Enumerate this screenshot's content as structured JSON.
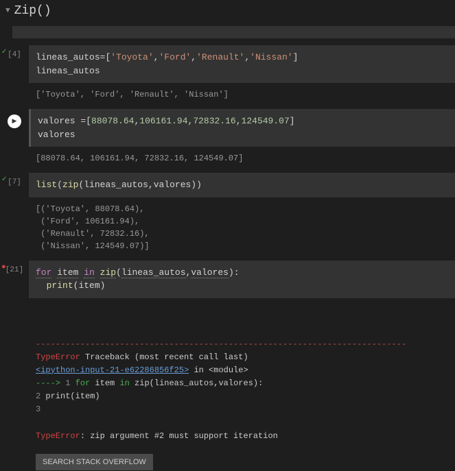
{
  "header": {
    "title": "Zip()"
  },
  "cells": [
    {
      "exec": "[4]",
      "status": "ok",
      "code_tokens": [
        {
          "t": "lineas_autos",
          "c": "c-var"
        },
        {
          "t": "=",
          "c": "c-op"
        },
        {
          "t": "[",
          "c": "c-pun"
        },
        {
          "t": "'Toyota'",
          "c": "c-str"
        },
        {
          "t": ",",
          "c": "c-pun"
        },
        {
          "t": "'Ford'",
          "c": "c-str"
        },
        {
          "t": ",",
          "c": "c-pun"
        },
        {
          "t": "'Renault'",
          "c": "c-str"
        },
        {
          "t": ",",
          "c": "c-pun"
        },
        {
          "t": "'Nissan'",
          "c": "c-str"
        },
        {
          "t": "]",
          "c": "c-pun"
        },
        {
          "t": "\n",
          "c": ""
        },
        {
          "t": "lineas_autos",
          "c": "c-var"
        }
      ],
      "output": "['Toyota', 'Ford', 'Renault', 'Nissan']"
    },
    {
      "exec": "",
      "status": "play",
      "code_tokens": [
        {
          "t": "valores ",
          "c": "c-var"
        },
        {
          "t": "=",
          "c": "c-op"
        },
        {
          "t": "[",
          "c": "c-pun"
        },
        {
          "t": "88078.64",
          "c": "c-num"
        },
        {
          "t": ",",
          "c": "c-pun"
        },
        {
          "t": "106161.94",
          "c": "c-num"
        },
        {
          "t": ",",
          "c": "c-pun"
        },
        {
          "t": "72832.16",
          "c": "c-num"
        },
        {
          "t": ",",
          "c": "c-pun"
        },
        {
          "t": "124549.07",
          "c": "c-num"
        },
        {
          "t": "]",
          "c": "c-pun"
        },
        {
          "t": "\n",
          "c": ""
        },
        {
          "t": "valores",
          "c": "c-var"
        }
      ],
      "output": "[88078.64, 106161.94, 72832.16, 124549.07]"
    },
    {
      "exec": "[7]",
      "status": "ok",
      "code_tokens": [
        {
          "t": "list",
          "c": "c-fn"
        },
        {
          "t": "(",
          "c": "c-pun"
        },
        {
          "t": "zip",
          "c": "c-fn"
        },
        {
          "t": "(",
          "c": "c-pun"
        },
        {
          "t": "lineas_autos",
          "c": "c-var"
        },
        {
          "t": ",",
          "c": "c-pun"
        },
        {
          "t": "valores",
          "c": "c-var"
        },
        {
          "t": ")",
          "c": "c-pun"
        },
        {
          "t": ")",
          "c": "c-pun"
        }
      ],
      "output": "[('Toyota', 88078.64),\n ('Ford', 106161.94),\n ('Renault', 72832.16),\n ('Nissan', 124549.07)]"
    },
    {
      "exec": "[21]",
      "status": "err",
      "code_tokens": [
        {
          "t": "for",
          "c": "c-kw c-under"
        },
        {
          "t": " ",
          "c": ""
        },
        {
          "t": "item",
          "c": "c-var c-under"
        },
        {
          "t": " ",
          "c": ""
        },
        {
          "t": "in",
          "c": "c-kw c-under"
        },
        {
          "t": " ",
          "c": ""
        },
        {
          "t": "zip",
          "c": "c-fn c-under"
        },
        {
          "t": "(",
          "c": "c-pun"
        },
        {
          "t": "lineas_autos",
          "c": "c-var c-under"
        },
        {
          "t": ",",
          "c": "c-pun"
        },
        {
          "t": "valores",
          "c": "c-var c-under"
        },
        {
          "t": ")",
          "c": "c-pun"
        },
        {
          "t": ":",
          "c": "c-pun"
        },
        {
          "t": "\n",
          "c": ""
        },
        {
          "t": "  ",
          "c": ""
        },
        {
          "t": "print",
          "c": "c-fn"
        },
        {
          "t": "(",
          "c": "c-pun"
        },
        {
          "t": "item",
          "c": "c-var"
        },
        {
          "t": ")",
          "c": "c-pun"
        }
      ],
      "error": {
        "dashes": "---------------------------------------------------------------------------",
        "type_line_left": "TypeError",
        "type_line_right": "Traceback (most recent call last)",
        "link": "<ipython-input-21-e62286856f25>",
        "link_suffix": " in <module>",
        "frame_lines": [
          {
            "arrow": "----> ",
            "num": "1",
            "indent": " ",
            "kw1": "for",
            "mid1": " item ",
            "kw2": "in",
            "mid2": " zip(lineas_autos,valores):"
          },
          {
            "arrow": "      ",
            "num": "2",
            "indent": "   ",
            "txt": "print(item)"
          },
          {
            "arrow": "      ",
            "num": "3",
            "indent": "",
            "txt": ""
          }
        ],
        "final_type": "TypeError",
        "final_msg": ": zip argument #2 must support iteration"
      },
      "button": "SEARCH STACK OVERFLOW"
    }
  ]
}
